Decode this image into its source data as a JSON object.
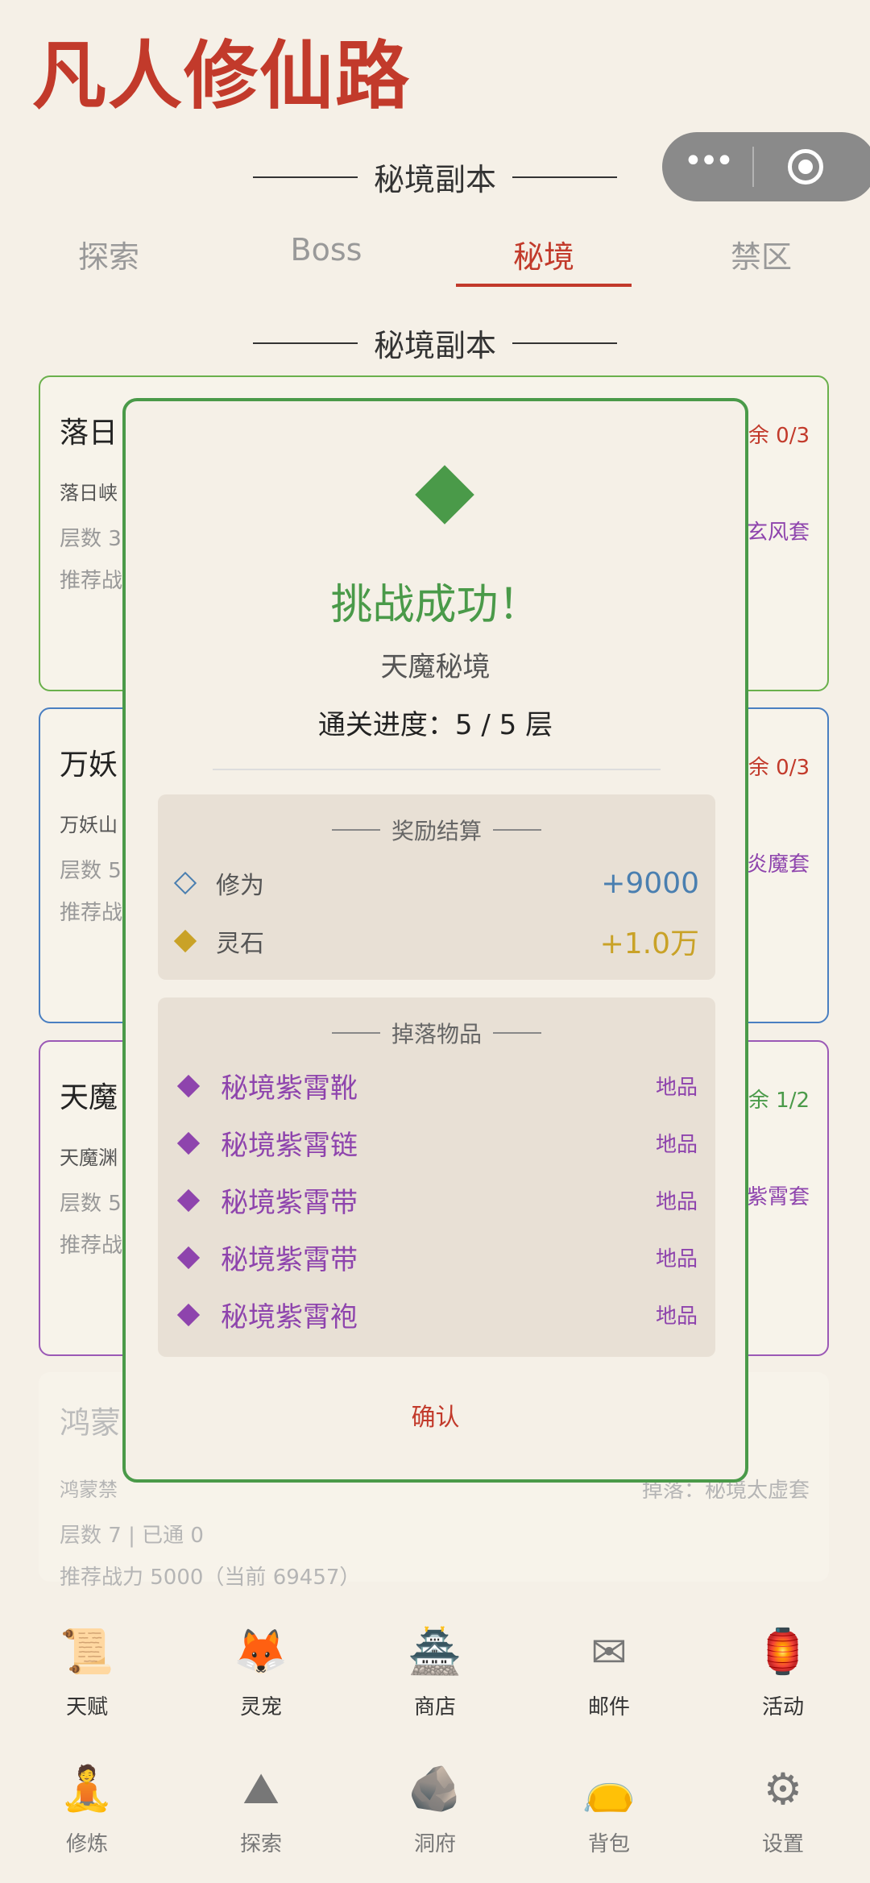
{
  "app_title": "凡人修仙路",
  "header_section_title": "秘境副本",
  "tabs": [
    {
      "label": "探索",
      "active": false
    },
    {
      "label": "Boss",
      "active": false
    },
    {
      "label": "秘境",
      "active": true
    },
    {
      "label": "禁区",
      "active": false
    }
  ],
  "list_section_title": "秘境副本",
  "cards": [
    {
      "name": "落日",
      "info1": "落日峡",
      "info2": "层数 3",
      "info3": "推荐战",
      "remain": "余 0/3",
      "drop": "玄风套",
      "color": "#6ab04c"
    },
    {
      "name": "万妖",
      "info1": "万妖山",
      "info2": "层数 5",
      "info3": "推荐战",
      "remain": "余 0/3",
      "drop": "炎魔套",
      "color": "#4a7fc1"
    },
    {
      "name": "天魔",
      "info1": "天魔渊",
      "info2": "层数 5",
      "info3": "推荐战",
      "remain": "剩余 1/2",
      "drop": "紫霄套",
      "color": "#9b59b6"
    },
    {
      "name": "鸿蒙",
      "info1": "鸿蒙禁",
      "info2": "层数 7 | 已通 0",
      "info3": "推荐战力 5000（当前 69457）",
      "remain": "",
      "drop": "掉落：秘境太虚套",
      "color": "transparent"
    }
  ],
  "nav_row1": [
    {
      "label": "天赋",
      "icon": "scroll-icon",
      "glyph": "📜"
    },
    {
      "label": "灵宠",
      "icon": "fox-icon",
      "glyph": "🦊"
    },
    {
      "label": "商店",
      "icon": "pagoda-icon",
      "glyph": "🏯"
    },
    {
      "label": "邮件",
      "icon": "envelope-icon",
      "glyph": "✉"
    },
    {
      "label": "活动",
      "icon": "lantern-icon",
      "glyph": "🏮"
    }
  ],
  "nav_row2": [
    {
      "label": "修炼",
      "icon": "meditation-icon",
      "glyph": "🧘"
    },
    {
      "label": "探索",
      "icon": "mountain-icon",
      "glyph": "⛰"
    },
    {
      "label": "洞府",
      "icon": "cave-icon",
      "glyph": "🪨"
    },
    {
      "label": "背包",
      "icon": "bag-icon",
      "glyph": "👝"
    },
    {
      "label": "设置",
      "icon": "gear-icon",
      "glyph": "⚙"
    }
  ],
  "modal": {
    "title": "挑战成功！",
    "realm": "天魔秘境",
    "progress": "通关进度：5 / 5 层",
    "rewards_title": "奖励结算",
    "rewards": [
      {
        "label": "修为",
        "value": "+9000",
        "color": "#4a7fb0",
        "filled": false
      },
      {
        "label": "灵石",
        "value": "+1.0万",
        "color": "#c9a227",
        "filled": true
      }
    ],
    "drops_title": "掉落物品",
    "drops": [
      {
        "name": "秘境紫霄靴",
        "grade": "地品"
      },
      {
        "name": "秘境紫霄链",
        "grade": "地品"
      },
      {
        "name": "秘境紫霄带",
        "grade": "地品"
      },
      {
        "name": "秘境紫霄带",
        "grade": "地品"
      },
      {
        "name": "秘境紫霄袍",
        "grade": "地品"
      }
    ],
    "confirm_label": "确认",
    "accent": "#4a9a49"
  }
}
